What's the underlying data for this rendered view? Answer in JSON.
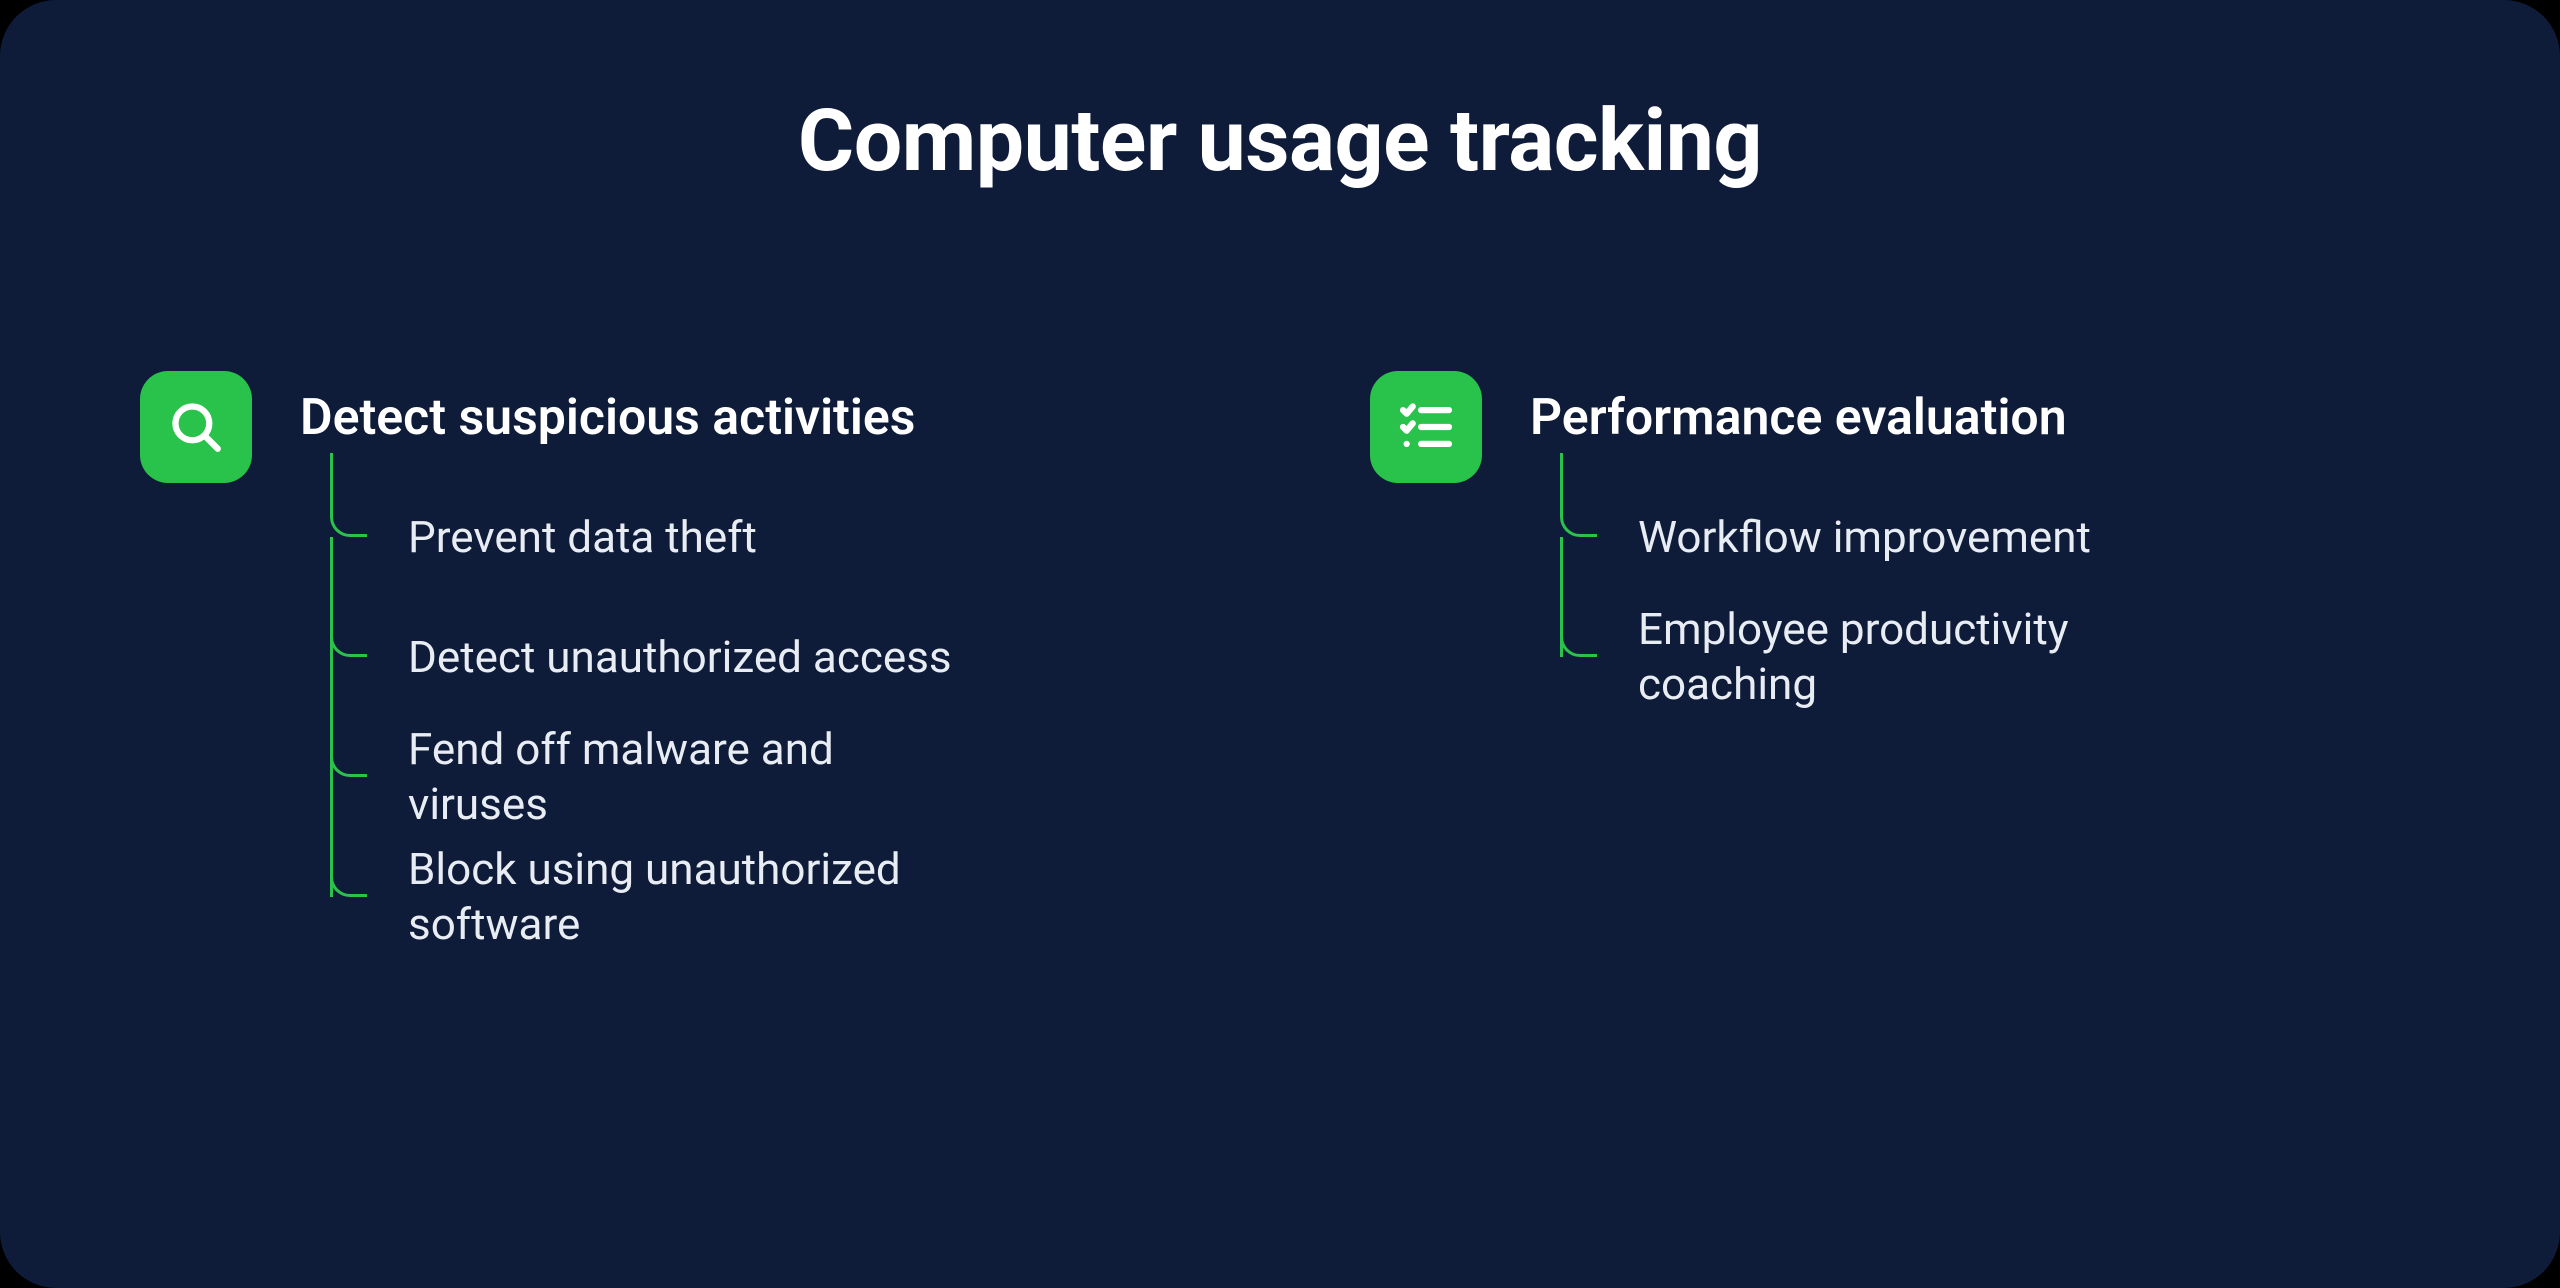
{
  "title": "Computer usage tracking",
  "colors": {
    "accent": "#29c24a",
    "bg": "#0f1c39",
    "text": "#ffffff"
  },
  "columns": [
    {
      "icon": "search-icon",
      "heading": "Detect suspicious activities",
      "items": [
        "Prevent data theft",
        "Detect unauthorized access",
        "Fend off malware and viruses",
        "Block using unauthorized software"
      ]
    },
    {
      "icon": "checklist-icon",
      "heading": "Performance evaluation",
      "items": [
        "Workflow improvement",
        "Employee productivity coaching"
      ]
    }
  ]
}
